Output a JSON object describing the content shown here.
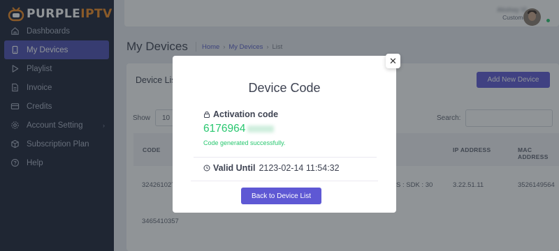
{
  "brand": {
    "logo_white": "PURPLE",
    "logo_orange": "IPTV"
  },
  "sidebar": {
    "items": [
      {
        "label": "Dashboards",
        "icon": "home-icon"
      },
      {
        "label": "My Devices",
        "icon": "device-icon",
        "active": true
      },
      {
        "label": "Playlist",
        "icon": "play-icon"
      },
      {
        "label": "Invoice",
        "icon": "file-icon"
      },
      {
        "label": "Credits",
        "icon": "credit-card-icon"
      },
      {
        "label": "Account Setting",
        "icon": "gear-icon",
        "has_submenu": true
      },
      {
        "label": "Subscription Plan",
        "icon": "box-icon"
      },
      {
        "label": "Help",
        "icon": "help-icon"
      }
    ]
  },
  "topbar": {
    "user_name": "Akshay Vi",
    "user_role": "Customer"
  },
  "page": {
    "title": "My Devices",
    "breadcrumb": [
      "Home",
      "My Devices",
      "List"
    ]
  },
  "card": {
    "title": "Device List",
    "add_button": "Add New Device",
    "show_label": "Show",
    "show_value": "10",
    "search_label": "Search:",
    "columns": {
      "code": "CODE",
      "ip": "IP ADDRESS",
      "mac": "MAC ADDRESS"
    },
    "rows": [
      {
        "code": "324261027",
        "model": "S : SDK : 30",
        "ip": "3.22.51.11",
        "mac": "3526149564"
      },
      {
        "code": "3465410357"
      }
    ]
  },
  "modal": {
    "title": "Device Code",
    "activation_label": "Activation code",
    "activation_code": "6176964",
    "success_text": "Code generated successfully.",
    "valid_until_label": "Valid Until",
    "valid_until_value": "2123-02-14 11:54:32",
    "back_button": "Back to Device List",
    "close_symbol": "✕"
  },
  "colors": {
    "sidebar_bg": "#1c2237",
    "accent": "#5e58d4",
    "success": "#28c76f",
    "logo_orange": "#f08a22"
  }
}
